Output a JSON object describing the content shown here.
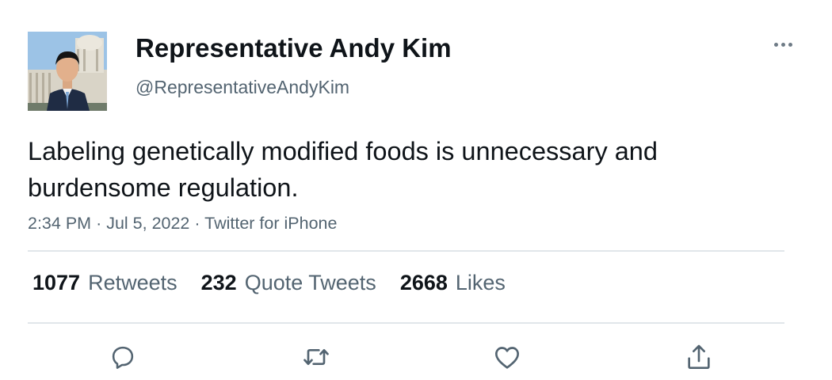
{
  "author": {
    "display_name": "Representative Andy Kim",
    "handle": "@RepresentativeAndyKim",
    "avatar_icon": "profile-photo"
  },
  "tweet": {
    "text": "Labeling genetically modified foods is unnecessary and burdensome regulation.",
    "time": "2:34 PM",
    "date": "Jul 5, 2022",
    "source": "Twitter for iPhone",
    "separator": "·"
  },
  "stats": {
    "retweets": {
      "count": "1077",
      "label": "Retweets"
    },
    "quote_tweets": {
      "count": "232",
      "label": "Quote Tweets"
    },
    "likes": {
      "count": "2668",
      "label": "Likes"
    }
  },
  "actions": {
    "reply_icon": "comment-icon",
    "retweet_icon": "retweet-icon",
    "like_icon": "heart-icon",
    "share_icon": "share-icon",
    "more_icon": "more-horizontal-icon"
  },
  "colors": {
    "text_primary": "#0f1419",
    "text_secondary": "#536471",
    "divider": "#e1e6ea",
    "icon": "#536471"
  }
}
